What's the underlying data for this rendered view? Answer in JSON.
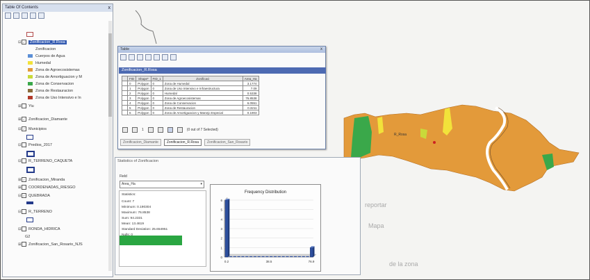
{
  "toc": {
    "title": "Table Of Contents",
    "close": "x",
    "layers": [
      {
        "name": "Zonificacion_R.Rosa",
        "selected": true
      },
      {
        "name": "Yiu"
      },
      {
        "name": "Zonificacion_Diamante"
      },
      {
        "name": "Municipios"
      },
      {
        "name": "Predios_2017"
      },
      {
        "name": "R_TERRENO_CAQUETA"
      },
      {
        "name": "Zonificacion_Miranda"
      },
      {
        "name": "COORDENADAS_RIESGO"
      },
      {
        "name": "QUEBRADA"
      },
      {
        "name": "R_TERRENO"
      },
      {
        "name": "RONDA_HIDRICA"
      },
      {
        "name": "Zonificacion_San_Rosario_NJS"
      }
    ],
    "legend": [
      {
        "label": "Zonificacion",
        "color": ""
      },
      {
        "label": "Cuerpos de Agua",
        "color": "#5b8fd6"
      },
      {
        "label": "Humedal",
        "color": "#f2e23a"
      },
      {
        "label": "Zona de Agroecosistemas",
        "color": "#e39a3a"
      },
      {
        "label": "Zona de Amortiguacion y M",
        "color": "#c9d93a"
      },
      {
        "label": "Zona de Conservacion",
        "color": "#3aa84a"
      },
      {
        "label": "Zona de Restauracion",
        "color": "#8a6a3a"
      },
      {
        "label": "Zona de Uso Intensivo e In",
        "color": "#b23a2a"
      }
    ],
    "small_label": "G2"
  },
  "table": {
    "title": "Table",
    "close": "x",
    "tab_title": "Zonificacion_R.Rosa",
    "columns": [
      "FID",
      "Shape*",
      "FID_1",
      "Zonificaci",
      "Area_Ha"
    ],
    "rows": [
      {
        "fid": "0",
        "shape": "Polygon",
        "fid1": "0",
        "zon": "Zona de Humedal",
        "area": "3.1774"
      },
      {
        "fid": "1",
        "shape": "Polygon",
        "fid1": "0",
        "zon": "Zona de Uso Intensivo e Infraestructura",
        "area": "7.09"
      },
      {
        "fid": "2",
        "shape": "Polygon",
        "fid1": "0",
        "zon": "Humedal",
        "area": "0.5338"
      },
      {
        "fid": "3",
        "shape": "Polygon",
        "fid1": "0",
        "zon": "Zona de Agroecosistemas",
        "area": "76.8538"
      },
      {
        "fid": "4",
        "shape": "Polygon",
        "fid1": "0",
        "zon": "Zona de Conservacion",
        "area": "6.0551"
      },
      {
        "fid": "5",
        "shape": "Polygon",
        "fid1": "0",
        "zon": "Zona de Restauracion",
        "area": "0.3211"
      },
      {
        "fid": "6",
        "shape": "Polygon",
        "fid1": "0",
        "zon": "Zona de Amortiguacion y Manejo Especial",
        "area": "0.1903"
      }
    ],
    "record_pos": "1",
    "selected_text": "(0 out of 7 Selected)",
    "bottom_tabs": [
      "Zonificacion_Diamante",
      "Zonificacion_R.Rosa",
      "Zonificacion_San_Rosario"
    ]
  },
  "stats": {
    "title": "Statistics of Zonificacion",
    "field_label": "Field",
    "field_value": "Area_Ha",
    "header": "Statistics:",
    "items": [
      {
        "k": "Count",
        "v": "7"
      },
      {
        "k": "Minimum",
        "v": "0.190304"
      },
      {
        "k": "Maximum",
        "v": "76.8538"
      },
      {
        "k": "Sum",
        "v": "94.2331"
      },
      {
        "k": "Mean",
        "v": "13.4619"
      },
      {
        "k": "Standard Deviation",
        "v": "25.654951"
      },
      {
        "k": "Nulls",
        "v": "0"
      }
    ]
  },
  "chart_data": {
    "type": "bar",
    "title": "Frequency Distribution",
    "categories": [
      "0.2",
      "",
      "",
      "",
      "",
      "",
      "",
      "",
      "",
      "",
      "",
      "",
      "",
      "",
      "",
      "",
      "",
      "",
      "",
      "",
      "",
      ""
    ],
    "values": [
      6,
      0,
      0,
      0,
      0,
      0,
      0,
      0,
      0,
      0,
      0,
      0,
      0,
      0,
      0,
      0,
      0,
      0,
      0,
      0,
      0,
      1
    ],
    "x_tick_labels": [
      "0.2",
      "38.5",
      "76.9"
    ],
    "ylim": [
      0,
      6
    ],
    "y_ticks": [
      "0",
      "1",
      "2",
      "3",
      "4",
      "5",
      "6"
    ],
    "colors": {
      "bar": "#2d4f9e"
    }
  },
  "map": {
    "colors": {
      "agro": "#e39a3a",
      "conservation": "#3aa84a",
      "humedal": "#f2e23a",
      "restoration": "#8a6a3a",
      "river": "#ffffff"
    },
    "label": "R_Rosa"
  },
  "background_text": [
    "reportar",
    "Mapa",
    "de la zona"
  ]
}
